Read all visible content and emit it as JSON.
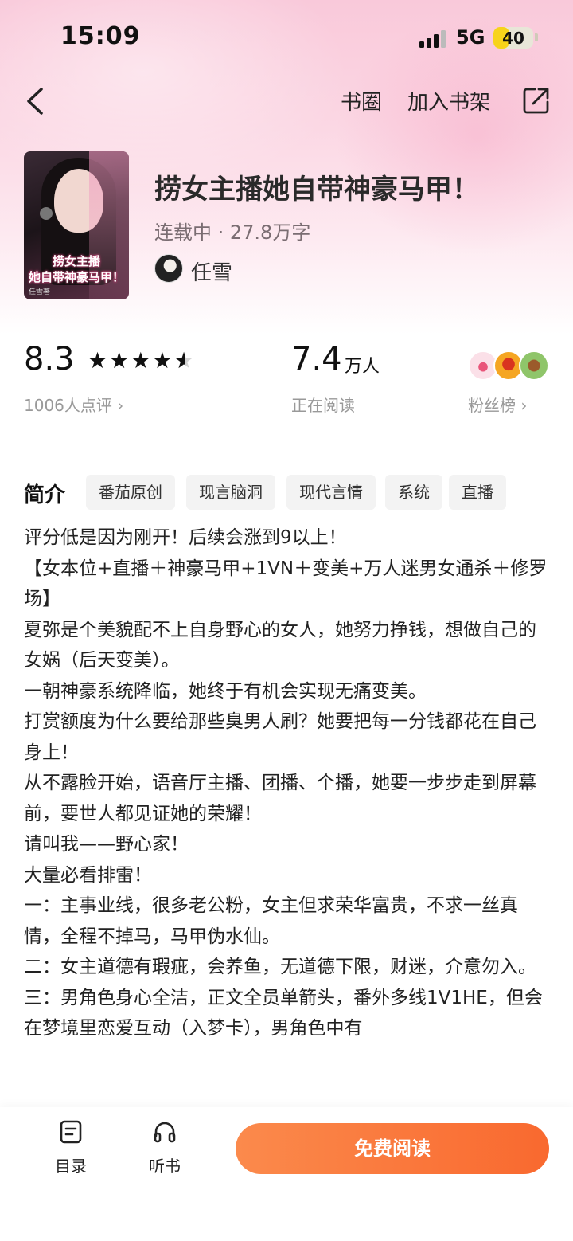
{
  "status_bar": {
    "time": "15:09",
    "network": "5G",
    "battery": "40",
    "battery_level": 0.4
  },
  "nav": {
    "circle": "书圈",
    "add_shelf": "加入书架"
  },
  "book": {
    "title": "捞女主播她自带神豪马甲！",
    "meta": "连载中 · 27.8万字",
    "author": "任雪",
    "cover_title_line1": "捞女主播",
    "cover_title_line2": "她自带神豪马甲！",
    "cover_author": "任雪著"
  },
  "stats": {
    "score": "8.3",
    "stars": 4.5,
    "rating_count": "1006人点评 ›",
    "readers": "7.4",
    "readers_unit": "万人",
    "readers_label": "正在阅读",
    "fans_label": "粉丝榜 ›"
  },
  "intro": {
    "heading": "简介",
    "tags": [
      "番茄原创",
      "现言脑洞",
      "现代言情",
      "系统",
      "直播"
    ],
    "paragraphs": [
      "评分低是因为刚开！后续会涨到9以上！",
      "【女本位+直播＋神豪马甲+1VN＋变美+万人迷男女通杀＋修罗场】",
      "夏弥是个美貌配不上自身野心的女人，她努力挣钱，想做自己的女娲（后天变美）。",
      "一朝神豪系统降临，她终于有机会实现无痛变美。",
      "打赏额度为什么要给那些臭男人刷？她要把每一分钱都花在自己身上！",
      "从不露脸开始，语音厅主播、团播、个播，她要一步步走到屏幕前，要世人都见证她的荣耀！",
      "请叫我——野心家！",
      "大量必看排雷！",
      "一：主事业线，很多老公粉，女主但求荣华富贵，不求一丝真情，全程不掉马，马甲伪水仙。",
      "二：女主道德有瑕疵，会养鱼，无道德下限，财迷，介意勿入。",
      "三：男角色身心全洁，正文全员单箭头，番外多线1V1HE，但会在梦境里恋爱互动（入梦卡），男角色中有"
    ]
  },
  "bottom_bar": {
    "catalog": "目录",
    "listen": "听书",
    "read": "免费阅读"
  },
  "colors": {
    "accent": "#f9692f",
    "accent_light": "#fb8a4c",
    "hero_pink": "#f9c9da"
  },
  "icons": [
    "back-arrow-icon",
    "share-icon",
    "star-icon",
    "catalog-icon",
    "headphones-icon"
  ]
}
